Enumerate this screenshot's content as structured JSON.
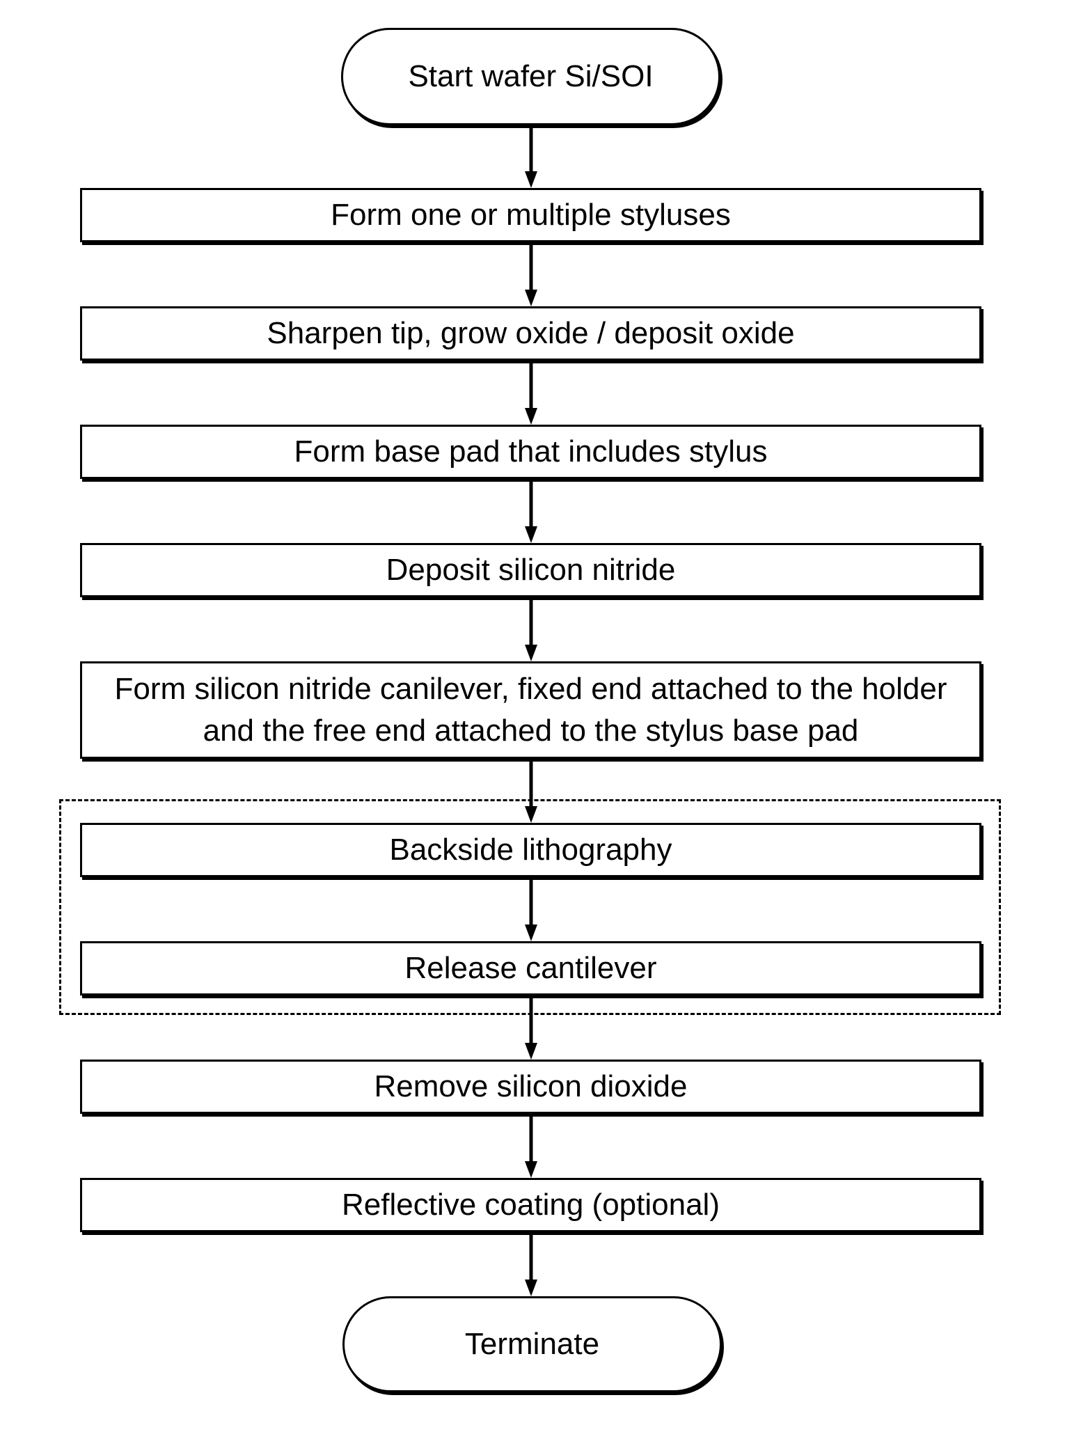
{
  "diagram": {
    "type": "flowchart",
    "direction": "top-to-bottom",
    "nodes": [
      {
        "id": "start",
        "shape": "terminal",
        "label": "Start wafer Si/SOI"
      },
      {
        "id": "step1",
        "shape": "process",
        "label": "Form one or multiple styluses"
      },
      {
        "id": "step2",
        "shape": "process",
        "label": "Sharpen tip, grow oxide / deposit oxide"
      },
      {
        "id": "step3",
        "shape": "process",
        "label": "Form base pad that includes stylus"
      },
      {
        "id": "step4",
        "shape": "process",
        "label": "Deposit silicon nitride"
      },
      {
        "id": "step5",
        "shape": "process",
        "label": "Form silicon nitride canilever, fixed end attached to the holder and the free end attached to the stylus base pad"
      },
      {
        "id": "step6",
        "shape": "process",
        "label": "Backside lithography",
        "group": "optional-group"
      },
      {
        "id": "step7",
        "shape": "process",
        "label": "Release cantilever",
        "group": "optional-group"
      },
      {
        "id": "step8",
        "shape": "process",
        "label": "Remove silicon dioxide"
      },
      {
        "id": "step9",
        "shape": "process",
        "label": "Reflective coating (optional)"
      },
      {
        "id": "end",
        "shape": "terminal",
        "label": "Terminate"
      }
    ],
    "edges": [
      [
        "start",
        "step1"
      ],
      [
        "step1",
        "step2"
      ],
      [
        "step2",
        "step3"
      ],
      [
        "step3",
        "step4"
      ],
      [
        "step4",
        "step5"
      ],
      [
        "step5",
        "step6"
      ],
      [
        "step6",
        "step7"
      ],
      [
        "step7",
        "step8"
      ],
      [
        "step8",
        "step9"
      ],
      [
        "step9",
        "end"
      ]
    ],
    "groups": [
      {
        "id": "optional-group",
        "style": "dashed",
        "members": [
          "step6",
          "step7"
        ]
      }
    ]
  }
}
